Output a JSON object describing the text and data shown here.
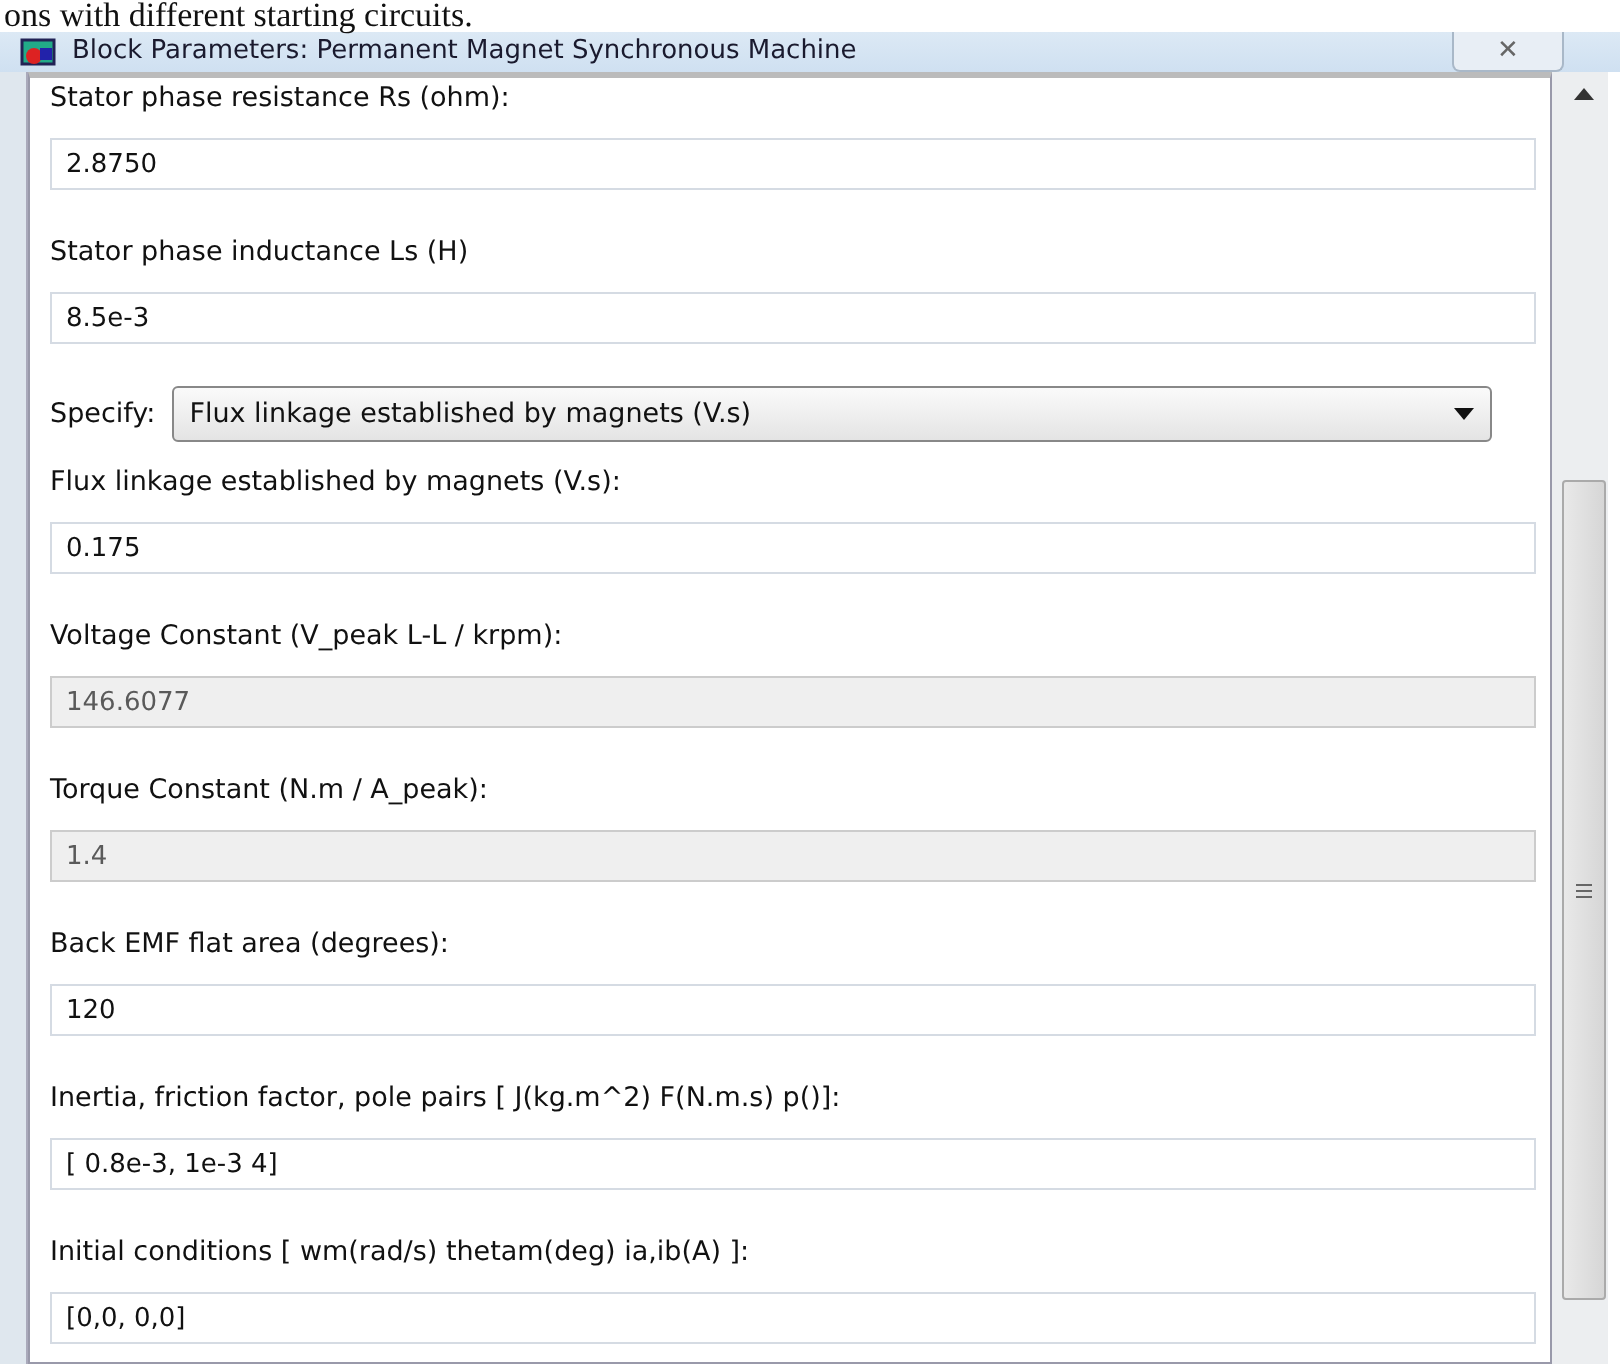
{
  "caption": "ons with different starting circuits.",
  "window": {
    "title": "Block Parameters: Permanent Magnet Synchronous Machine",
    "close": "✕"
  },
  "fields": [
    {
      "kind": "text",
      "label": "Stator phase resistance Rs (ohm):",
      "value": "2.8750",
      "disabled": false
    },
    {
      "kind": "text",
      "label": "Stator phase inductance Ls (H)",
      "value": "8.5e-3",
      "disabled": false
    },
    {
      "kind": "select",
      "label": "Specify:",
      "value": "Flux linkage established by magnets (V.s)"
    },
    {
      "kind": "text",
      "label": "Flux linkage established by magnets (V.s):",
      "value": "0.175",
      "disabled": false
    },
    {
      "kind": "text",
      "label": "Voltage Constant (V_peak L-L / krpm):",
      "value": "146.6077",
      "disabled": true
    },
    {
      "kind": "text",
      "label": "Torque Constant (N.m / A_peak):",
      "value": "1.4",
      "disabled": true
    },
    {
      "kind": "text",
      "label": "Back EMF flat area (degrees):",
      "value": "120",
      "disabled": false
    },
    {
      "kind": "text",
      "label": "Inertia, friction factor, pole pairs [ J(kg.m^2)  F(N.m.s)  p()]:",
      "value": "[ 0.8e-3, 1e-3 4]",
      "disabled": false
    },
    {
      "kind": "text",
      "label": "Initial conditions  [ wm(rad/s)  thetam(deg)  ia,ib(A) ]:",
      "value": "[0,0, 0,0]",
      "disabled": false
    }
  ]
}
